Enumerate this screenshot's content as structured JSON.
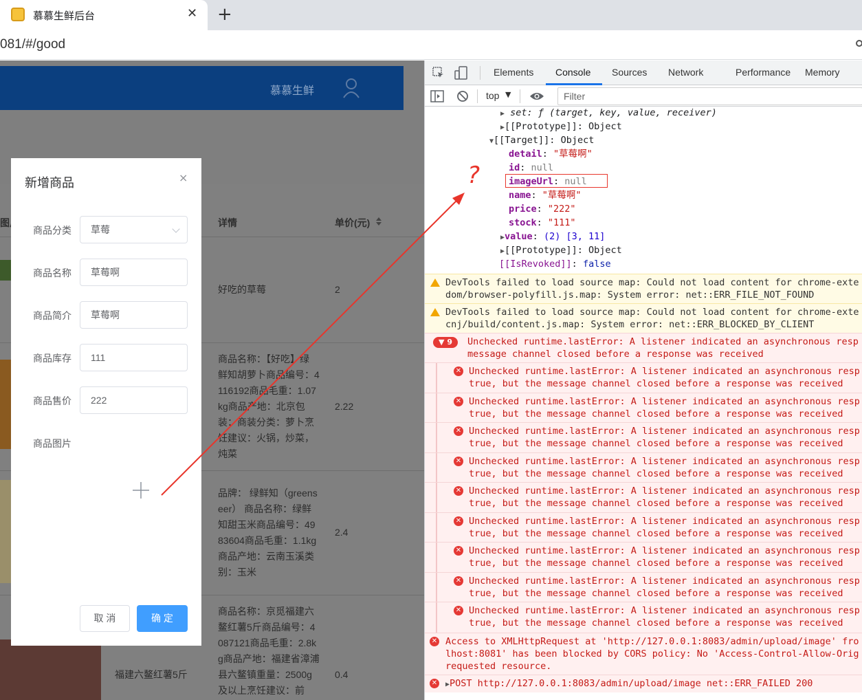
{
  "browser": {
    "tab_title": "慕慕生鲜后台",
    "tab_close": "✕",
    "new_tab": "+",
    "url": "081/#/good"
  },
  "app": {
    "brand": "慕慕生鲜",
    "table_headers": {
      "col_image": "图片",
      "col_detail": "详情",
      "col_price": "单价(元)"
    },
    "rows": [
      {
        "detail_lines": [
          "好吃的草莓"
        ],
        "price": "2"
      },
      {
        "detail_lines": [
          "商品名称：【好吃】绿",
          "鲜知胡萝卜商品编号：4",
          "116192商品毛重：1.07",
          "kg商品产地：北京包",
          "装：商装分类：萝卜烹",
          "饪建议：火锅，炒菜，",
          "炖菜"
        ],
        "price": "2.22"
      },
      {
        "detail_lines": [
          "品牌： 绿鲜知（greens",
          "eer） 商品名称：绿鲜",
          "知甜玉米商品编号：49",
          "83604商品毛重：1.1kg",
          "商品产地：云南玉溪类",
          "别：玉米"
        ],
        "price": "2.4"
      },
      {
        "name": "福建六鳌红薯5斤",
        "detail_lines": [
          "商品名称：京觅福建六",
          "鳌红薯5斤商品编号：4",
          "087121商品毛重：2.8k",
          "g商品产地：福建省漳浦",
          "县六鳌镇重量：2500g",
          "及以上烹饪建议：前"
        ],
        "price": "0.4"
      }
    ]
  },
  "modal": {
    "title": "新增商品",
    "close": "×",
    "fields": {
      "category_label": "商品分类",
      "category_value": "草莓",
      "name_label": "商品名称",
      "name_value": "草莓啊",
      "intro_label": "商品简介",
      "intro_value": "草莓啊",
      "stock_label": "商品库存",
      "stock_value": "111",
      "price_label": "商品售价",
      "price_value": "222",
      "image_label": "商品图片"
    },
    "cancel": "取 消",
    "confirm": "确 定"
  },
  "devtools": {
    "tabs": [
      "Elements",
      "Console",
      "Sources",
      "Network",
      "Performance",
      "Memory"
    ],
    "active_tab": "Console",
    "context": "top",
    "filter_placeholder": "Filter",
    "tree": {
      "set_line": "set: ƒ (target, key, value, receiver)",
      "proto1": "[[Prototype]]: Object",
      "target": "[[Target]]: Object",
      "detail_key": "detail",
      "detail_val": "\"草莓啊\"",
      "id_key": "id",
      "id_val": "null",
      "imageUrl_key": "imageUrl",
      "imageUrl_val": "null",
      "name_key": "name",
      "name_val": "\"草莓啊\"",
      "price_key": "price",
      "price_val": "\"222\"",
      "stock_key": "stock",
      "stock_val": "\"111\"",
      "value_key": "value",
      "value_val": "(2) [3, 11]",
      "proto2": "[[Prototype]]: Object",
      "revoked_key": "[[IsRevoked]]",
      "revoked_val": "false"
    },
    "warnings": [
      {
        "line1": "DevTools failed to load source map: Could not load content for chrome-exte",
        "line2": "dom/browser-polyfill.js.map: System error: net::ERR_FILE_NOT_FOUND"
      },
      {
        "line1": "DevTools failed to load source map: Could not load content for chrome-exte",
        "line2": "cnj/build/content.js.map: System error: net::ERR_BLOCKED_BY_CLIENT"
      }
    ],
    "group_count": "9",
    "group_line1": "Unchecked runtime.lastError: A listener indicated an asynchronous resp",
    "group_line2": "message channel closed before a response was received",
    "error_line1": "Unchecked runtime.lastError: A listener indicated an asynchronous resp",
    "error_line2": "true, but the message channel closed before a response was received",
    "cors_line1": "Access to XMLHttpRequest at 'http://127.0.0.1:8083/admin/upload/image' fro",
    "cors_line2": "lhost:8081' has been blocked by CORS policy: No 'Access-Control-Allow-Orig",
    "cors_line3": "requested resource.",
    "post_line": "POST http://127.0.0.1:8083/admin/upload/image net::ERR_FAILED 200"
  },
  "annotation": {
    "mark": "?"
  },
  "colors": {
    "header_blue": "#0b3f7f",
    "primary": "#409eff",
    "error_red": "#e53935",
    "annotation_red": "#e8352b"
  }
}
